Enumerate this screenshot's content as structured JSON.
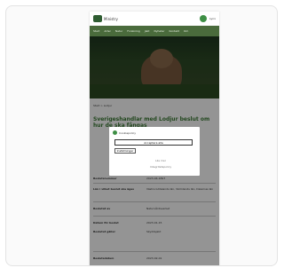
{
  "header": {
    "logo_text": "Ministry",
    "partner_text": "Lynx"
  },
  "nav": {
    "items": [
      "Start",
      "Arter",
      "Natur",
      "Forskning",
      "Jakt",
      "Nyheter",
      "Kontakt",
      "Om"
    ]
  },
  "breadcrumb": "Start > Lodjur",
  "page": {
    "title": "Sverigeshandlar med Lodjur beslut om hur de ska fångas"
  },
  "details": [
    {
      "key": "Beslutsnummer",
      "value": "2023-04-1897"
    },
    {
      "key": "Län i vilket beslut ska ägas",
      "value": "Västra Götalands län, Värmlands län, Dalarnas län"
    },
    {
      "key": "Beslutat av",
      "value": "Naturvårdsverket"
    },
    {
      "key": "Datum för beslut",
      "value": "2023-01-15"
    },
    {
      "key": "Beslutet gäller",
      "value": "Skyddsjakt"
    },
    {
      "key": "Beslutsdatum",
      "value": "2023-02-01"
    }
  ],
  "dialog": {
    "title": "Cookiepolicy",
    "accept_label": "Acceptera alla",
    "settings_label": "Inställningar",
    "links": [
      "Läs mer",
      "Integritetspolicy"
    ]
  },
  "colors": {
    "brand_green": "#3b7a35",
    "nav_bg": "#4a6b3c",
    "overlay": "rgba(0,0,0,0.42)"
  }
}
